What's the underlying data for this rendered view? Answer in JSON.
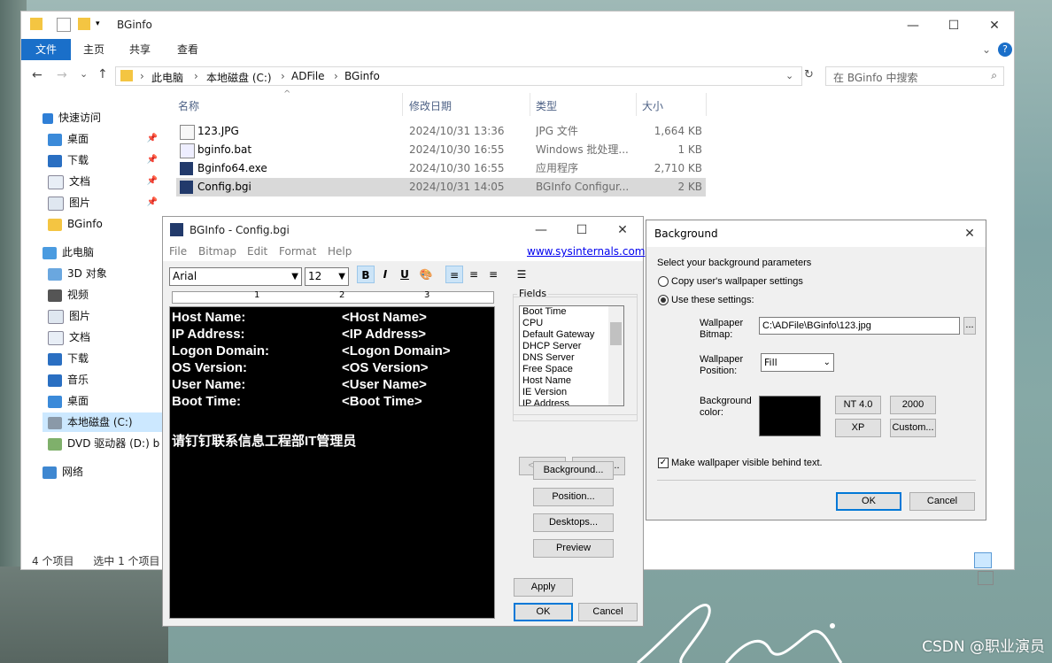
{
  "explorer": {
    "title": "BGinfo",
    "ribbon_tabs": [
      "文件",
      "主页",
      "共享",
      "查看"
    ],
    "address": {
      "crumbs": [
        "此电脑",
        "本地磁盘 (C:)",
        "ADFile",
        "BGinfo"
      ]
    },
    "search_placeholder": "在 BGinfo 中搜索",
    "nav": [
      {
        "label": "快速访问",
        "pinned": false
      },
      {
        "label": "桌面",
        "pinned": true
      },
      {
        "label": "下载",
        "pinned": true
      },
      {
        "label": "文档",
        "pinned": true
      },
      {
        "label": "图片",
        "pinned": true
      },
      {
        "label": "BGinfo",
        "pinned": false
      },
      {
        "label": "此电脑",
        "pinned": false
      },
      {
        "label": "3D 对象",
        "pinned": false
      },
      {
        "label": "视频",
        "pinned": false
      },
      {
        "label": "图片",
        "pinned": false
      },
      {
        "label": "文档",
        "pinned": false
      },
      {
        "label": "下载",
        "pinned": false
      },
      {
        "label": "音乐",
        "pinned": false
      },
      {
        "label": "桌面",
        "pinned": false
      },
      {
        "label": "本地磁盘 (C:)",
        "pinned": false
      },
      {
        "label": "DVD 驱动器 (D:) b",
        "pinned": false
      },
      {
        "label": "网络",
        "pinned": false
      }
    ],
    "columns": [
      "名称",
      "修改日期",
      "类型",
      "大小"
    ],
    "files": [
      {
        "name": "123.JPG",
        "date": "2024/10/31 13:36",
        "type": "JPG 文件",
        "size": "1,664 KB"
      },
      {
        "name": "bginfo.bat",
        "date": "2024/10/30 16:55",
        "type": "Windows 批处理...",
        "size": "1 KB"
      },
      {
        "name": "Bginfo64.exe",
        "date": "2024/10/30 16:55",
        "type": "应用程序",
        "size": "2,710 KB"
      },
      {
        "name": "Config.bgi",
        "date": "2024/10/31 14:05",
        "type": "BGInfo Configur...",
        "size": "2 KB"
      }
    ],
    "status": {
      "count": "4 个项目",
      "selected": "选中 1 个项目"
    }
  },
  "bginfo": {
    "title": "BGInfo - Config.bgi",
    "menu": [
      "File",
      "Bitmap",
      "Edit",
      "Format",
      "Help"
    ],
    "link": "www.sysinternals.com",
    "font": "Arial",
    "size": "12",
    "toolbar": {
      "bold": "B",
      "italic": "I",
      "underline": "U"
    },
    "ruler": {
      "m1": "1",
      "m2": "2",
      "m3": "3"
    },
    "editor_lines": [
      {
        "label": "Host Name:",
        "value": "<Host Name>"
      },
      {
        "label": "IP Address:",
        "value": "<IP Address>"
      },
      {
        "label": "Logon Domain:",
        "value": "<Logon Domain>"
      },
      {
        "label": "OS Version:",
        "value": "<OS Version>"
      },
      {
        "label": "User Name:",
        "value": "<User Name>"
      },
      {
        "label": "Boot Time:",
        "value": "<Boot Time>"
      }
    ],
    "editor_note": "请钉钉联系信息工程部IT管理员",
    "fields_label": "Fields",
    "fields": [
      "Boot Time",
      "CPU",
      "Default Gateway",
      "DHCP Server",
      "DNS Server",
      "Free Space",
      "Host Name",
      "IE Version",
      "IP Address"
    ],
    "buttons": {
      "add": "<- Add",
      "custom": "Custom...",
      "background": "Background...",
      "position": "Position...",
      "desktops": "Desktops...",
      "preview": "Preview",
      "apply": "Apply",
      "ok": "OK",
      "cancel": "Cancel"
    }
  },
  "background_dialog": {
    "title": "Background",
    "heading": "Select your background parameters",
    "radio_copy": "Copy user's wallpaper settings",
    "radio_use": "Use these settings:",
    "wallpaper_bitmap_label_1": "Wallpaper",
    "wallpaper_bitmap_label_2": "Bitmap:",
    "wallpaper_bitmap_value": "C:\\ADFile\\BGinfo\\123.jpg",
    "browse": "...",
    "wallpaper_position_label_1": "Wallpaper",
    "wallpaper_position_label_2": "Position:",
    "wallpaper_position_value": "Fill",
    "bg_color_label_1": "Background",
    "bg_color_label_2": "color:",
    "bg_color": "#000000",
    "preset_buttons": [
      "NT 4.0",
      "2000",
      "XP",
      "Custom..."
    ],
    "make_visible": "Make wallpaper visible behind text.",
    "ok": "OK",
    "cancel": "Cancel"
  },
  "watermark": "CSDN @职业演员"
}
